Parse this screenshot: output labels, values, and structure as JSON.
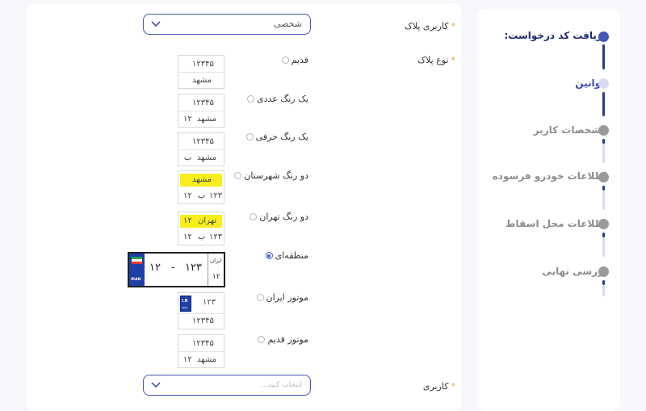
{
  "stepper": {
    "steps": [
      {
        "label": "دریافت کد درخواست:",
        "state": "active"
      },
      {
        "label": "قوانین",
        "state": "current"
      },
      {
        "label": "مشخصات کاربر",
        "state": "pending"
      },
      {
        "label": "اطلاعات خودرو فرسوده",
        "state": "pending"
      },
      {
        "label": "اطلاعات محل اسقاط",
        "state": "pending"
      },
      {
        "label": "بررسی نهایی",
        "state": "pending"
      }
    ]
  },
  "form": {
    "plate_usage": {
      "label": "کاربری پلاک",
      "required_mark": "*",
      "value": "شخصی"
    },
    "plate_type": {
      "label": "نوع پلاک",
      "required_mark": "*"
    },
    "usage": {
      "label": "کاربری",
      "required_mark": "*",
      "placeholder": "انتخاب کنید..."
    }
  },
  "plate_options": [
    {
      "label": "قدیم",
      "selected": false
    },
    {
      "label": "یک رنگ عددی",
      "selected": false
    },
    {
      "label": "یک رنگ حرفی",
      "selected": false
    },
    {
      "label": "دو رنگ شهرستان",
      "selected": false
    },
    {
      "label": "دو رنگ تهران",
      "selected": false
    },
    {
      "label": "منطقه‌ای",
      "selected": true
    },
    {
      "label": "موتور ایران",
      "selected": false
    },
    {
      "label": "موتور قدیم",
      "selected": false
    }
  ],
  "plates": {
    "old": {
      "number": "۱۲۳۴۵",
      "city": "مشهد"
    },
    "numeric": {
      "number": "۱۲۳۴۵",
      "city": "مشهد",
      "code": "۱۲"
    },
    "letter": {
      "number": "۱۲۳۴۵",
      "city": "مشهد",
      "letter": "ب"
    },
    "city_two_color": {
      "city": "مشهد",
      "number": "۱۲۳",
      "letter": "ب",
      "code": "۱۲"
    },
    "tehran_two_color": {
      "city": "تهران",
      "city_code": "۱۲",
      "number": "۱۲۳",
      "letter": "ب",
      "code": "۱۲"
    },
    "regional": {
      "country_label": "ایران",
      "code": "۱۲",
      "number": "۱۲۳",
      "dash": "-",
      "number2": "۱۲",
      "badge_top": "I.R",
      "badge_bottom": "IRAN"
    },
    "moto_iran": {
      "badge_top": "I.R",
      "badge_bottom": "IRAN",
      "number_top": "۱۲۳",
      "number_bottom": "۱۲۳۴۵"
    },
    "moto_old": {
      "number": "۱۲۳۴۵",
      "city": "مشهد",
      "code": "۱۲"
    }
  },
  "colors": {
    "accent": "#4a56b3",
    "highlight": "#f7ee1c",
    "required": "#e7a32c",
    "plate_blue": "#1e3fa5"
  },
  "icons": {
    "select_arrow": "chevron-down-icon",
    "radio": "radio-icon",
    "flag": "iran-flag-icon"
  }
}
